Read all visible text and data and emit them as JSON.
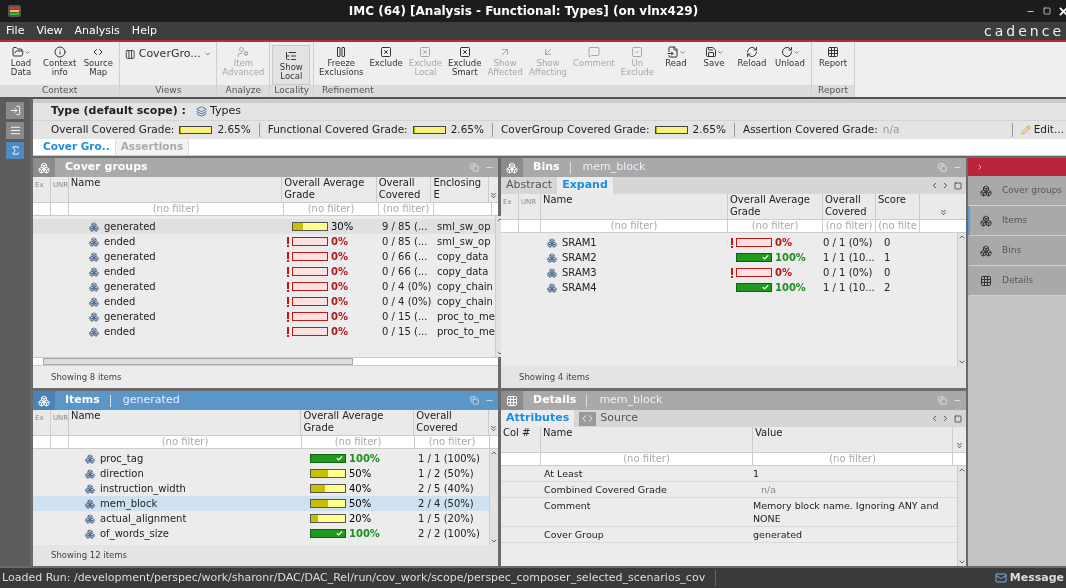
{
  "window": {
    "title": "IMC (64) [Analysis - Functional: Types] (on vlnx429)"
  },
  "menu": [
    "File",
    "View",
    "Analysis",
    "Help"
  ],
  "brand": "cadence",
  "toolbar": {
    "groups": [
      {
        "label": "Context",
        "buttons": [
          {
            "kind": "button",
            "lines": [
              "Load",
              "Data"
            ],
            "disabled": false,
            "dropdown": true,
            "pressed": false
          },
          {
            "kind": "button",
            "lines": [
              "Context",
              "info"
            ],
            "disabled": false,
            "dropdown": false,
            "pressed": false
          },
          {
            "kind": "button",
            "lines": [
              "Source",
              "Map"
            ],
            "disabled": false,
            "dropdown": false,
            "pressed": false
          }
        ]
      },
      {
        "label": "Views",
        "buttons": [
          {
            "kind": "combo",
            "lines": [
              "CoverGro..."
            ],
            "disabled": false,
            "dropdown": true,
            "pressed": false
          }
        ]
      },
      {
        "label": "Analyze",
        "buttons": [
          {
            "kind": "button",
            "lines": [
              "Item",
              "Advanced"
            ],
            "disabled": true,
            "dropdown": false,
            "pressed": false
          }
        ]
      },
      {
        "label": "Locality",
        "buttons": [
          {
            "kind": "button",
            "lines": [
              "Show",
              "Local"
            ],
            "disabled": false,
            "dropdown": false,
            "pressed": true
          }
        ]
      },
      {
        "label": "Refinement",
        "buttons": [
          {
            "kind": "button",
            "lines": [
              "Freeze",
              "Exclusions"
            ],
            "disabled": false,
            "dropdown": false,
            "pressed": false
          },
          {
            "kind": "button",
            "lines": [
              "Exclude"
            ],
            "disabled": false,
            "dropdown": false,
            "pressed": false
          },
          {
            "kind": "button",
            "lines": [
              "Exclude",
              "Local"
            ],
            "disabled": true,
            "dropdown": false,
            "pressed": false
          },
          {
            "kind": "button",
            "lines": [
              "Exclude",
              "Smart"
            ],
            "disabled": false,
            "dropdown": false,
            "pressed": false
          },
          {
            "kind": "button",
            "lines": [
              "Show",
              "Affected"
            ],
            "disabled": true,
            "dropdown": false,
            "pressed": false
          },
          {
            "kind": "button",
            "lines": [
              "Show",
              "Affecting"
            ],
            "disabled": true,
            "dropdown": false,
            "pressed": false
          },
          {
            "kind": "button",
            "lines": [
              "Comment"
            ],
            "disabled": true,
            "dropdown": false,
            "pressed": false
          },
          {
            "kind": "button",
            "lines": [
              "Un",
              "Exclude"
            ],
            "disabled": true,
            "dropdown": false,
            "pressed": false
          },
          {
            "kind": "button",
            "lines": [
              "Read"
            ],
            "disabled": false,
            "dropdown": true,
            "pressed": false
          },
          {
            "kind": "button",
            "lines": [
              "Save"
            ],
            "disabled": false,
            "dropdown": true,
            "pressed": false
          },
          {
            "kind": "button",
            "lines": [
              "Reload"
            ],
            "disabled": false,
            "dropdown": false,
            "pressed": false
          },
          {
            "kind": "button",
            "lines": [
              "Unload"
            ],
            "disabled": false,
            "dropdown": true,
            "pressed": false
          }
        ]
      },
      {
        "label": "Report",
        "buttons": [
          {
            "kind": "button",
            "lines": [
              "Report"
            ],
            "disabled": false,
            "dropdown": false,
            "pressed": false
          }
        ]
      }
    ]
  },
  "side_strip": [
    {
      "selected": false
    },
    {
      "selected": false
    },
    {
      "selected": true
    }
  ],
  "scope": {
    "label": "Type (default scope) :",
    "value": "Types"
  },
  "grades": [
    {
      "kind": "bar",
      "label": "Overall Covered Grade:",
      "level": 0.0265,
      "value": "2.65%"
    },
    {
      "kind": "bar",
      "label": "Functional Covered Grade:",
      "level": 0.0265,
      "value": "2.65%"
    },
    {
      "kind": "bar",
      "label": "CoverGroup Covered Grade:",
      "level": 0.0265,
      "value": "2.65%"
    },
    {
      "kind": "na",
      "label": "Assertion Covered Grade:",
      "value": "n/a"
    }
  ],
  "edit_button": "Edit...",
  "tabs": [
    {
      "label": "Cover Gro..",
      "selected": true
    },
    {
      "label": "Assertions",
      "selected": false
    }
  ],
  "cover_groups": {
    "title": "Cover groups",
    "columns": [
      {
        "label": "Ex"
      },
      {
        "label": "UNR"
      },
      {
        "label": "Name",
        "filter": "(no filter)"
      },
      {
        "label": "Overall Average Grade",
        "filter": "(no filter)"
      },
      {
        "label": "Overall Covered",
        "filter": "(no filter)"
      },
      {
        "label": "Enclosing E"
      }
    ],
    "rows": [
      {
        "name": "generated",
        "grade": {
          "kind": "partial",
          "level": 0.3,
          "text": "30%"
        },
        "covered": "9 / 85 (...",
        "enclosing": "sml_sw_op",
        "selected": true
      },
      {
        "name": "ended",
        "grade": {
          "kind": "fail",
          "level": 0,
          "text": "0%"
        },
        "covered": "0 / 85 (...",
        "enclosing": "sml_sw_op",
        "selected": false
      },
      {
        "name": "generated",
        "grade": {
          "kind": "fail",
          "level": 0,
          "text": "0%"
        },
        "covered": "0 / 66 (...",
        "enclosing": "copy_data",
        "selected": false
      },
      {
        "name": "ended",
        "grade": {
          "kind": "fail",
          "level": 0,
          "text": "0%"
        },
        "covered": "0 / 66 (...",
        "enclosing": "copy_data",
        "selected": false
      },
      {
        "name": "generated",
        "grade": {
          "kind": "fail",
          "level": 0,
          "text": "0%"
        },
        "covered": "0 / 4 (0%)",
        "enclosing": "copy_chain",
        "selected": false
      },
      {
        "name": "ended",
        "grade": {
          "kind": "fail",
          "level": 0,
          "text": "0%"
        },
        "covered": "0 / 4 (0%)",
        "enclosing": "copy_chain",
        "selected": false
      },
      {
        "name": "generated",
        "grade": {
          "kind": "fail",
          "level": 0,
          "text": "0%"
        },
        "covered": "0 / 15 (...",
        "enclosing": "proc_to_me",
        "selected": false
      },
      {
        "name": "ended",
        "grade": {
          "kind": "fail",
          "level": 0,
          "text": "0%"
        },
        "covered": "0 / 15 (...",
        "enclosing": "proc_to_me",
        "selected": false
      }
    ],
    "footer": "Showing 8 items"
  },
  "bins": {
    "title": "Bins",
    "context": "mem_block",
    "subtabs": [
      {
        "label": "Abstract",
        "selected": false
      },
      {
        "label": "Expand",
        "selected": true
      }
    ],
    "columns": [
      {
        "label": "Ex"
      },
      {
        "label": "UNR"
      },
      {
        "label": "Name",
        "filter": "(no filter)"
      },
      {
        "label": "Overall Average Grade",
        "filter": "(no filter)"
      },
      {
        "label": "Overall Covered",
        "filter": "(no filter)"
      },
      {
        "label": "Score",
        "filter": "(no filte"
      }
    ],
    "rows": [
      {
        "name": "SRAM1",
        "grade": {
          "kind": "fail",
          "level": 0,
          "text": "0%"
        },
        "covered": "0 / 1 (0%)",
        "score": "0"
      },
      {
        "name": "SRAM2",
        "grade": {
          "kind": "pass",
          "level": 1,
          "text": "100%"
        },
        "covered": "1 / 1 (10...",
        "score": "1"
      },
      {
        "name": "SRAM3",
        "grade": {
          "kind": "fail",
          "level": 0,
          "text": "0%"
        },
        "covered": "0 / 1 (0%)",
        "score": "0"
      },
      {
        "name": "SRAM4",
        "grade": {
          "kind": "pass",
          "level": 1,
          "text": "100%"
        },
        "covered": "1 / 1 (10...",
        "score": "2"
      }
    ],
    "footer": "Showing 4 items"
  },
  "items": {
    "title": "Items",
    "context": "generated",
    "active": true,
    "columns": [
      {
        "label": "Ex"
      },
      {
        "label": "UNR"
      },
      {
        "label": "Name",
        "filter": "(no filter)"
      },
      {
        "label": "Overall Average Grade",
        "filter": "(no filter)"
      },
      {
        "label": "Overall Covered",
        "filter": "(no filter)"
      }
    ],
    "rows": [
      {
        "name": "proc_tag",
        "grade": {
          "kind": "pass",
          "level": 1,
          "text": "100%"
        },
        "covered": "1 / 1 (100%)",
        "selected": false
      },
      {
        "name": "direction",
        "grade": {
          "kind": "partial",
          "level": 0.5,
          "text": "50%"
        },
        "covered": "1 / 2 (50%)",
        "selected": false
      },
      {
        "name": "instruction_width",
        "grade": {
          "kind": "partial",
          "level": 0.4,
          "text": "40%"
        },
        "covered": "2 / 5 (40%)",
        "selected": false
      },
      {
        "name": "mem_block",
        "grade": {
          "kind": "partial",
          "level": 0.5,
          "text": "50%"
        },
        "covered": "2 / 4 (50%)",
        "selected": true
      },
      {
        "name": "actual_alignment",
        "grade": {
          "kind": "partial",
          "level": 0.2,
          "text": "20%"
        },
        "covered": "1 / 5 (20%)",
        "selected": false
      },
      {
        "name": "of_words_size",
        "grade": {
          "kind": "pass",
          "level": 1,
          "text": "100%"
        },
        "covered": "2 / 2 (100%)",
        "selected": false
      }
    ],
    "footer": "Showing 12 items"
  },
  "details": {
    "title": "Details",
    "context": "mem_block",
    "subtabs": [
      {
        "label": "Attributes",
        "selected": true
      },
      {
        "label": "Source",
        "selected": false
      }
    ],
    "columns": [
      {
        "label": "Col #"
      },
      {
        "label": "Name",
        "filter": "(no filter)"
      },
      {
        "label": "Value",
        "filter": "(no filter)"
      }
    ],
    "rows": [
      {
        "name": "At Least",
        "value": "1",
        "muted": false
      },
      {
        "name": "Combined Covered Grade",
        "value": "n/a",
        "muted": true
      },
      {
        "name": "Comment",
        "value": "Memory block name. Ignoring ANY and NONE",
        "muted": false
      },
      {
        "name": "Cover Group",
        "value": "generated",
        "muted": false
      }
    ]
  },
  "views_sidebar": [
    {
      "label": "Cover groups",
      "selected": false
    },
    {
      "label": "Items",
      "selected": true
    },
    {
      "label": "Bins",
      "selected": false
    },
    {
      "label": "Details",
      "selected": false
    }
  ],
  "status_bar": {
    "path": "Loaded Run: /development/perspec/work/sharonr/DAC/DAC_Rel/run/cov_work/scope/perspec_composer_selected_scenarios_cov",
    "messages": "Message"
  }
}
